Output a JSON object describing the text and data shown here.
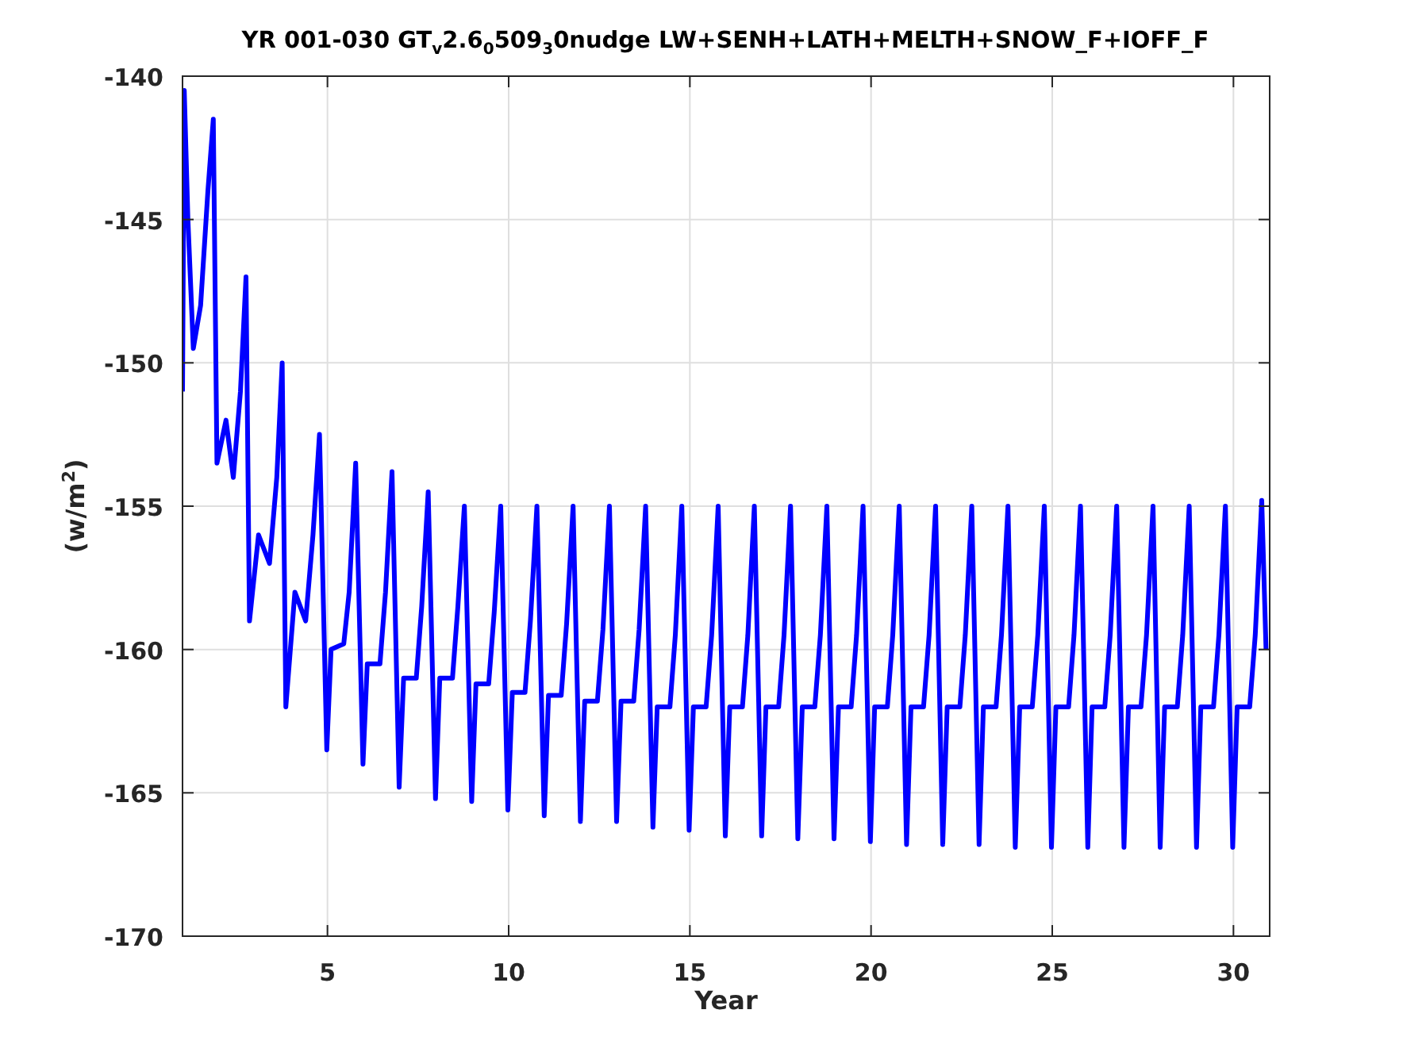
{
  "figure": {
    "chart_data": {
      "type": "line",
      "title": "YR 001-030 GT$_{v}$2.6$_{0}$509$_{3}$0nudge LW+SENH+LATH+MELTH+SNOW_F+IOFF_F",
      "xlabel": "Year",
      "ylabel": "(w/m$^{2}$)",
      "x": [
        1,
        1.05,
        1.15,
        1.3,
        1.5,
        1.7,
        1.85,
        1.95,
        2.2,
        2.4,
        2.6,
        2.75,
        2.85,
        3.1,
        3.4,
        3.6,
        3.75,
        3.85,
        4.1,
        4.4,
        4.6,
        4.78,
        4.98,
        5.1,
        5.45,
        5.6,
        5.78,
        5.98,
        6.1,
        6.45,
        6.6,
        6.78,
        6.98,
        7.1,
        7.45,
        7.6,
        7.78,
        7.98,
        8.1,
        8.45,
        8.6,
        8.78,
        8.98,
        9.1,
        9.45,
        9.6,
        9.78,
        9.98,
        10.1,
        10.45,
        10.6,
        10.78,
        10.98,
        11.1,
        11.45,
        11.6,
        11.78,
        11.98,
        12.1,
        12.45,
        12.6,
        12.78,
        12.98,
        13.1,
        13.45,
        13.6,
        13.78,
        13.98,
        14.1,
        14.45,
        14.6,
        14.78,
        14.98,
        15.1,
        15.45,
        15.6,
        15.78,
        15.98,
        16.1,
        16.45,
        16.6,
        16.78,
        16.98,
        17.1,
        17.45,
        17.6,
        17.78,
        17.98,
        18.1,
        18.45,
        18.6,
        18.78,
        18.98,
        19.1,
        19.45,
        19.6,
        19.78,
        19.98,
        20.1,
        20.45,
        20.6,
        20.78,
        20.98,
        21.1,
        21.45,
        21.6,
        21.78,
        21.98,
        22.1,
        22.45,
        22.6,
        22.78,
        22.98,
        23.1,
        23.45,
        23.6,
        23.78,
        23.98,
        24.1,
        24.45,
        24.6,
        24.78,
        24.98,
        25.1,
        25.45,
        25.6,
        25.78,
        25.98,
        26.1,
        26.45,
        26.6,
        26.78,
        26.98,
        27.1,
        27.45,
        27.6,
        27.78,
        27.98,
        28.1,
        28.45,
        28.6,
        28.78,
        28.98,
        29.1,
        29.45,
        29.6,
        29.78,
        29.98,
        30.1,
        30.45,
        30.6,
        30.78,
        30.9
      ],
      "series": [
        {
          "color": "#0000ff",
          "values": [
            -151,
            -140.5,
            -145,
            -149.5,
            -148,
            -144,
            -141.5,
            -153.5,
            -152,
            -154,
            -151,
            -147,
            -159,
            -156,
            -157,
            -154,
            -150,
            -162,
            -158,
            -159,
            -156,
            -152.5,
            -163.5,
            -160,
            -159.8,
            -158,
            -153.5,
            -164,
            -160.5,
            -160.5,
            -158,
            -153.8,
            -164.8,
            -161,
            -161,
            -158.5,
            -154.5,
            -165.2,
            -161,
            -161,
            -158.5,
            -155,
            -165.3,
            -161.2,
            -161.2,
            -158.7,
            -155,
            -165.6,
            -161.5,
            -161.5,
            -159,
            -155,
            -165.8,
            -161.6,
            -161.6,
            -159.1,
            -155,
            -166,
            -161.8,
            -161.8,
            -159.3,
            -155,
            -166,
            -161.8,
            -161.8,
            -159.3,
            -155,
            -166.2,
            -162,
            -162,
            -159.5,
            -155,
            -166.3,
            -162,
            -162,
            -159.5,
            -155,
            -166.5,
            -162,
            -162,
            -159.5,
            -155,
            -166.5,
            -162,
            -162,
            -159.5,
            -155,
            -166.6,
            -162,
            -162,
            -159.5,
            -155,
            -166.6,
            -162,
            -162,
            -159.5,
            -155,
            -166.7,
            -162,
            -162,
            -159.5,
            -155,
            -166.8,
            -162,
            -162,
            -159.5,
            -155,
            -166.8,
            -162,
            -162,
            -159.5,
            -155,
            -166.8,
            -162,
            -162,
            -159.5,
            -155,
            -166.9,
            -162,
            -162,
            -159.5,
            -155,
            -166.9,
            -162,
            -162,
            -159.5,
            -155,
            -166.9,
            -162,
            -162,
            -159.5,
            -155,
            -166.9,
            -162,
            -162,
            -159.5,
            -155,
            -166.9,
            -162,
            -162,
            -159.5,
            -155,
            -166.9,
            -162,
            -162,
            -159.5,
            -155,
            -166.9,
            -162,
            -162,
            -159.5,
            -154.8,
            -160
          ]
        }
      ],
      "grid": true,
      "xlim": [
        1,
        31
      ],
      "ylim": [
        -170,
        -140
      ],
      "xticks": [
        5,
        10,
        15,
        20,
        25,
        30
      ],
      "yticks": [
        -170,
        -165,
        -160,
        -155,
        -150,
        -145,
        -140
      ]
    }
  }
}
